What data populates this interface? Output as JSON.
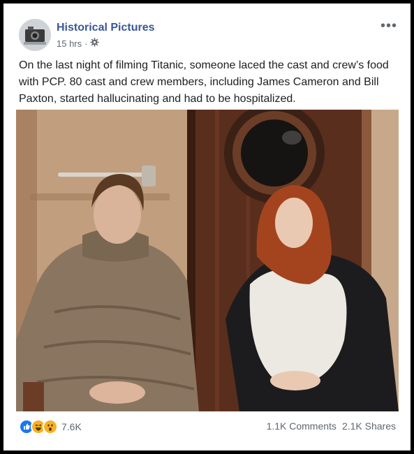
{
  "post": {
    "page_name": "Historical Pictures",
    "timestamp": "15 hrs",
    "separator": "·",
    "privacy_icon": "gear-icon",
    "more_icon": "more-options-icon",
    "more_label": "•••",
    "text": "On the last night of filming Titanic, someone laced the cast and crew’s food with PCP. 80 cast and crew members, including James Cameron and Bill Paxton, started hallucinating and had to be hospitalized."
  },
  "reactions": {
    "icons": [
      "like-icon",
      "haha-icon",
      "wow-icon"
    ],
    "count": "7.6K"
  },
  "stats": {
    "comments": "1.1K Comments",
    "shares": "2.1K Shares"
  },
  "colors": {
    "page_name": "#385898",
    "text": "#1c1e21",
    "meta": "#606770",
    "like": "#1877f2",
    "emoji": "#f7b125"
  }
}
